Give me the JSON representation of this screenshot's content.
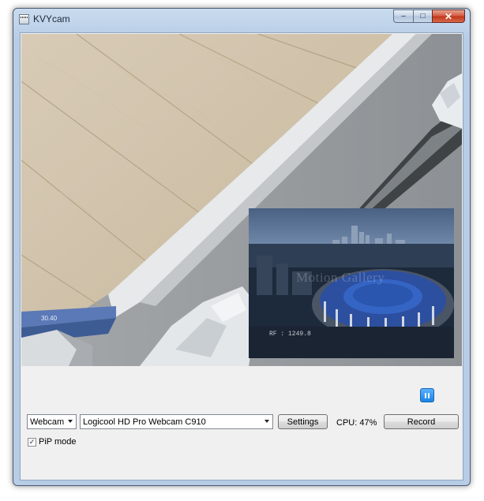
{
  "window": {
    "title": "KVYcam",
    "app_icon": "film-clapper-icon",
    "buttons": {
      "minimize": "–",
      "maximize": "□",
      "close": "✕"
    }
  },
  "video": {
    "description_icon": "webcam-feed",
    "pip": {
      "watermark": "Motion Gallery",
      "timecode": "RF : 1249.8"
    },
    "pause_icon": "pause-icon"
  },
  "controls": {
    "source_select": {
      "value": "Webcam"
    },
    "device_select": {
      "value": "Logicool HD Pro Webcam C910"
    },
    "settings_label": "Settings",
    "cpu_label": "CPU: 47%",
    "record_label": "Record",
    "pip_mode": {
      "label": "PiP mode",
      "checked": true,
      "check_glyph": "✓"
    }
  },
  "colors": {
    "titlebar": "#b7cde6",
    "client": "#f0f0f0",
    "close_button": "#c03418",
    "pause_button": "#1b84e6"
  }
}
